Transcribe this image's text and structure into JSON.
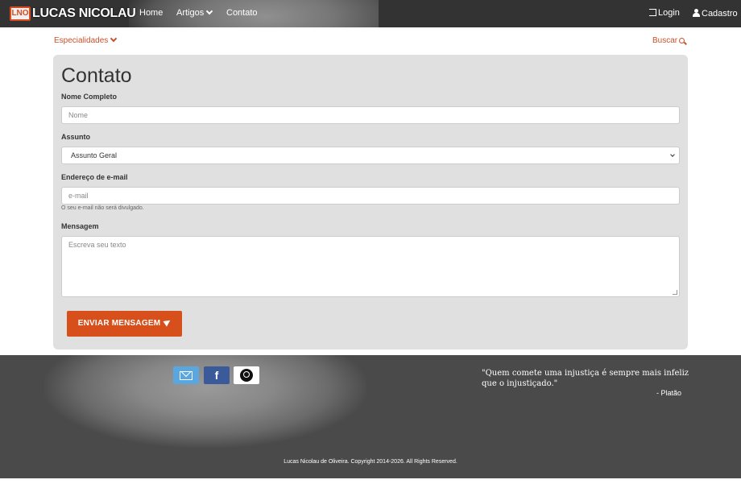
{
  "brand": {
    "mark": "LNO",
    "name": "LUCAS NICOLAU"
  },
  "nav": {
    "home": "Home",
    "artigos": "Artigos",
    "contato": "Contato",
    "login": "Login",
    "cadastro": "Cadastro"
  },
  "subnav": {
    "especialidades": "Especialidades",
    "buscar": "Buscar"
  },
  "form": {
    "title": "Contato",
    "name_label": "Nome Completo",
    "name_placeholder": "Nome",
    "subject_label": "Assunto",
    "subject_value": "Assunto Geral",
    "email_label": "Endereço de e-mail",
    "email_placeholder": "e-mail",
    "email_help": "O seu e-mail não será divulgado.",
    "message_label": "Mensagem",
    "message_placeholder": "Escreva seu texto",
    "submit_label": "ENVIAR MENSAGEM"
  },
  "footer": {
    "quote": "\"Quem comete uma injustiça é sempre mais infeliz que o injustiçado.\"",
    "author": "- Platão",
    "copyright": "Lucas Nicolau de Oliveira. Copyright 2014-2026. All Rights Reserved.",
    "social_icons": [
      "mail-icon",
      "facebook-icon",
      "profile-icon"
    ]
  },
  "colors": {
    "accent": "#d7501c",
    "navbar": "#333333",
    "footer": "#4a4a4a",
    "panel": "#e0e0e0"
  }
}
